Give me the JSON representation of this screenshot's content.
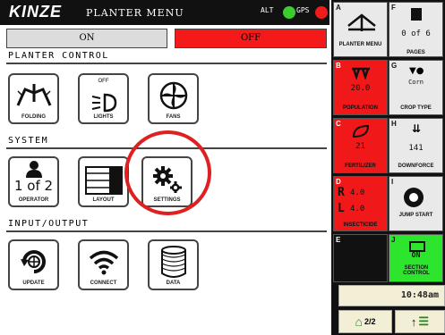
{
  "header": {
    "logo": "KINZE",
    "title": "PLANTER MENU",
    "alt_label": "ALT",
    "gps_label": "GPS",
    "colors": {
      "alt_status": "#3dcc2f",
      "gps_status": "#f01b1b"
    }
  },
  "toggle": {
    "on_label": "ON",
    "off_label": "OFF",
    "active": "OFF"
  },
  "sections": {
    "planter_control": {
      "title": "PLANTER CONTROL",
      "tiles": [
        {
          "label": "FOLDING",
          "icon": "folding-icon"
        },
        {
          "label": "LIGHTS",
          "sublabel": "OFF",
          "icon": "light-icon"
        },
        {
          "label": "FANS",
          "icon": "fan-icon"
        }
      ]
    },
    "system": {
      "title": "SYSTEM",
      "tiles": [
        {
          "label": "OPERATOR",
          "value": "1 of 2",
          "icon": "person-icon"
        },
        {
          "label": "LAYOUT",
          "icon": "layout-icon"
        },
        {
          "label": "SETTINGS",
          "icon": "gears-icon"
        }
      ]
    },
    "input_output": {
      "title": "INPUT/OUTPUT",
      "tiles": [
        {
          "label": "UPDATE",
          "icon": "update-icon"
        },
        {
          "label": "CONNECT",
          "icon": "wifi-icon"
        },
        {
          "label": "DATA",
          "icon": "database-icon"
        }
      ]
    }
  },
  "right_panel": {
    "cells": [
      {
        "letter": "A",
        "label": "PLANTER MENU",
        "icon": "planter-icon"
      },
      {
        "letter": "F",
        "value": "0 of 6",
        "label": "PAGES",
        "icon": "page-icon"
      },
      {
        "letter": "B",
        "value": "20.0",
        "label": "POPULATION",
        "icon": "seed-icon"
      },
      {
        "letter": "G",
        "value": "Corn",
        "label": "CROP TYPE",
        "icon": "seed-icon"
      },
      {
        "letter": "C",
        "value": "21",
        "label": "FERTILIZER",
        "icon": "fertilizer-icon"
      },
      {
        "letter": "H",
        "value": "141",
        "label": "DOWNFORCE",
        "icon": "downforce-icon"
      },
      {
        "letter": "D",
        "value_r": "4.0",
        "value_l": "4.0",
        "r": "R",
        "l": "L",
        "label": "INSECTICIDE"
      },
      {
        "letter": "I",
        "label": "JUMP START",
        "icon": "jump-start-icon"
      },
      {
        "letter": "E"
      },
      {
        "letter": "J",
        "value": "ON",
        "label": "SECTION CONTROL",
        "icon": "section-icon"
      }
    ],
    "time": "10:48am",
    "nav_page": "2/2"
  }
}
